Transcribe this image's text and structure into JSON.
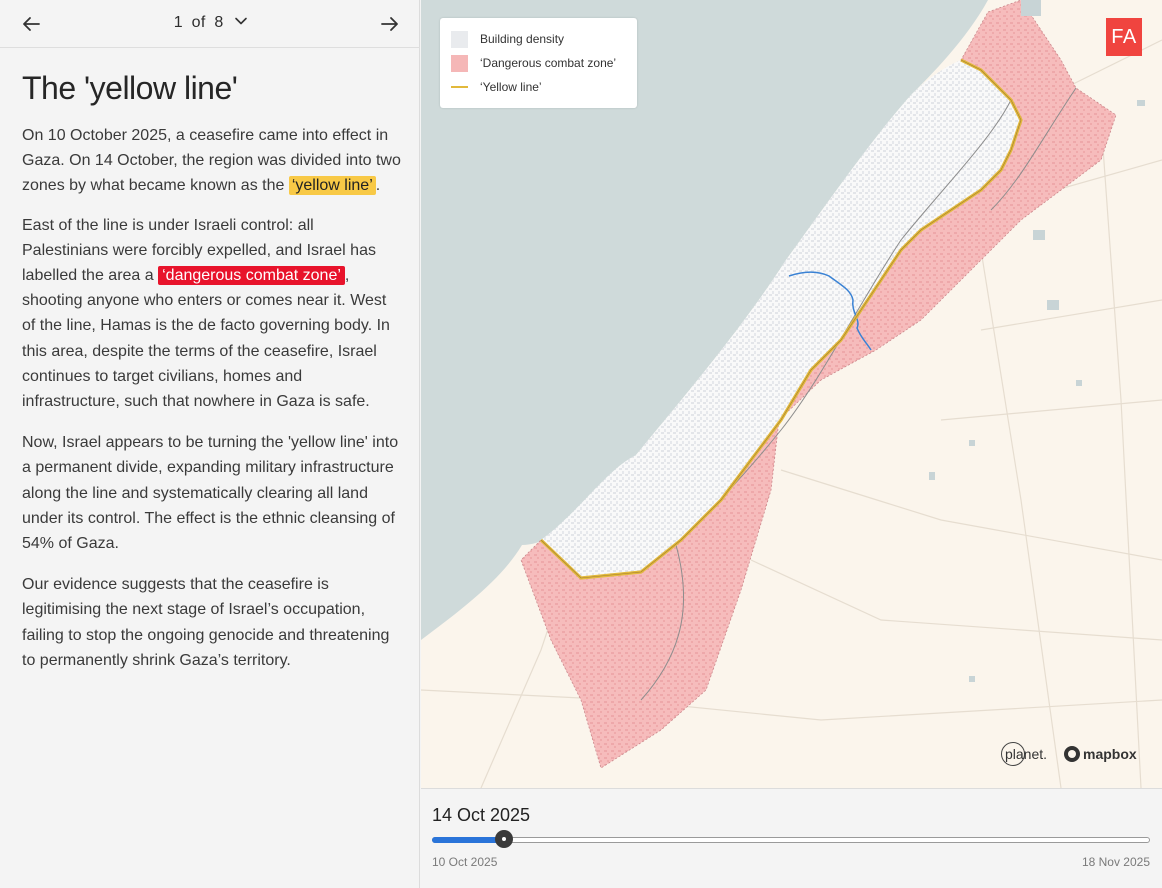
{
  "pager": {
    "current": "1",
    "of_label": "of",
    "total": "8"
  },
  "article": {
    "title": "The 'yellow line'",
    "p1_text": "On 10 October 2025, a ceasefire came into effect in Gaza. On 14 October, the region was divided into two zones by what became known as the ",
    "p1_highlight": "‘yellow line’",
    "p1_end": ".",
    "p2_start": "East of the line is under Israeli control: all Palestinians were forcibly expelled, and Israel has labelled the area a ",
    "p2_highlight": "‘dangerous combat zone’",
    "p2_end": ", shooting anyone who enters or comes near it. West of the line, Hamas is the de facto governing body. In this area, despite the terms of the ceasefire, Israel continues to target civilians, homes and infrastructure, such that nowhere in Gaza is safe.",
    "p3": "Now, Israel appears to be turning the 'yellow line' into a permanent divide, expanding military infrastructure along the line and systematically clearing all land under its control. The effect is the ethnic cleansing of 54% of Gaza.",
    "p4": "Our evidence suggests that the ceasefire is legitimising the next stage of Israel’s occupation, failing to stop the ongoing genocide and threatening to permanently shrink Gaza’s territory."
  },
  "highlight_colors": {
    "yellow_line": "#f8c946",
    "combat_zone": "#e8132b"
  },
  "map": {
    "legend": {
      "building_density": "Building density",
      "combat_zone": "‘Dangerous combat zone’",
      "yellow_line": "‘Yellow line’"
    },
    "colors": {
      "sea": "#cfdada",
      "land": "#fbf5ec",
      "combat_zone": "#f5b7b7",
      "yellow_line": "#e2b93b",
      "buildings": "#e9ebee"
    },
    "logo": "FA",
    "credit_planet": "planet.",
    "credit_mapbox": "mapbox"
  },
  "timeline": {
    "current_date": "14 Oct 2025",
    "start_date": "10 Oct 2025",
    "end_date": "18 Nov 2025",
    "progress": 0.1
  }
}
